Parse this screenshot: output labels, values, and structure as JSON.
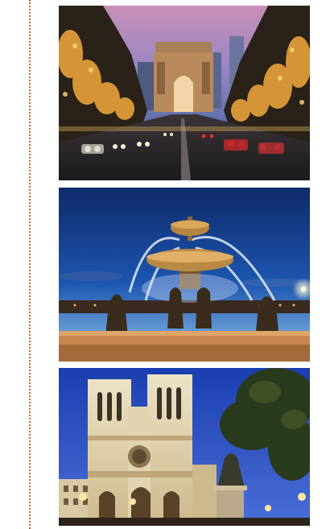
{
  "page": {
    "accent_color": "#d4622a",
    "background": "#ffffff"
  },
  "gallery": {
    "images": [
      {
        "subject": "arc-de-triomphe-champs-elysees-dusk"
      },
      {
        "subject": "fontaine-place-de-la-concorde-night"
      },
      {
        "subject": "notre-dame-cathedral-evening"
      }
    ]
  }
}
